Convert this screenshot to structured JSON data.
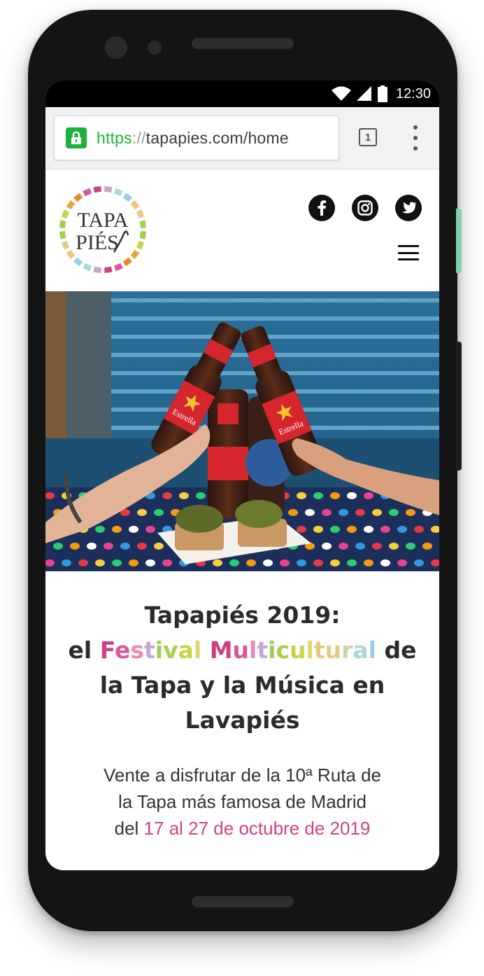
{
  "status_bar": {
    "time": "12:30"
  },
  "browser": {
    "url_scheme": "https",
    "url_separator": "://",
    "url_host": "tapapies.com/home",
    "tab_count": "1"
  },
  "header": {
    "logo_line1": "TAPA",
    "logo_line2": "PIÉS",
    "social": [
      "facebook-icon",
      "instagram-icon",
      "twitter-icon"
    ]
  },
  "hero": {
    "bottle_label": "Estrella"
  },
  "content": {
    "headline_line1": "Tapapiés 2019:",
    "headline_el": "el",
    "headline_festival_letters": [
      "F",
      "e",
      "s",
      "t",
      "i",
      "v",
      "a",
      "l"
    ],
    "headline_multicultural_letters": [
      "M",
      "u",
      "l",
      "t",
      "i",
      "c",
      "u",
      "l",
      "t",
      "u",
      "r",
      "a",
      "l"
    ],
    "headline_de": "de",
    "headline_line3": "la Tapa y la Música en",
    "headline_line4": "Lavapiés",
    "sub_line1": "Vente a disfrutar de la 10ª Ruta de",
    "sub_line2": "la Tapa más famosa de Madrid",
    "sub_line3_prefix": "del",
    "sub_line3_dates": "17 al 27 de octubre de 2019"
  },
  "colors": {
    "url_green": "#1db33a",
    "accent_pink": "#d13f83",
    "festival_palette": [
      "#d13f83",
      "#d9589a",
      "#e48bb8",
      "#c7a6d0",
      "#9fcb58",
      "#a8cf4a",
      "#c8d24a",
      "#e0d56a",
      "#e7c97b",
      "#e3cc8a",
      "#c9d7a6",
      "#aed6d6",
      "#9ccde0"
    ]
  }
}
